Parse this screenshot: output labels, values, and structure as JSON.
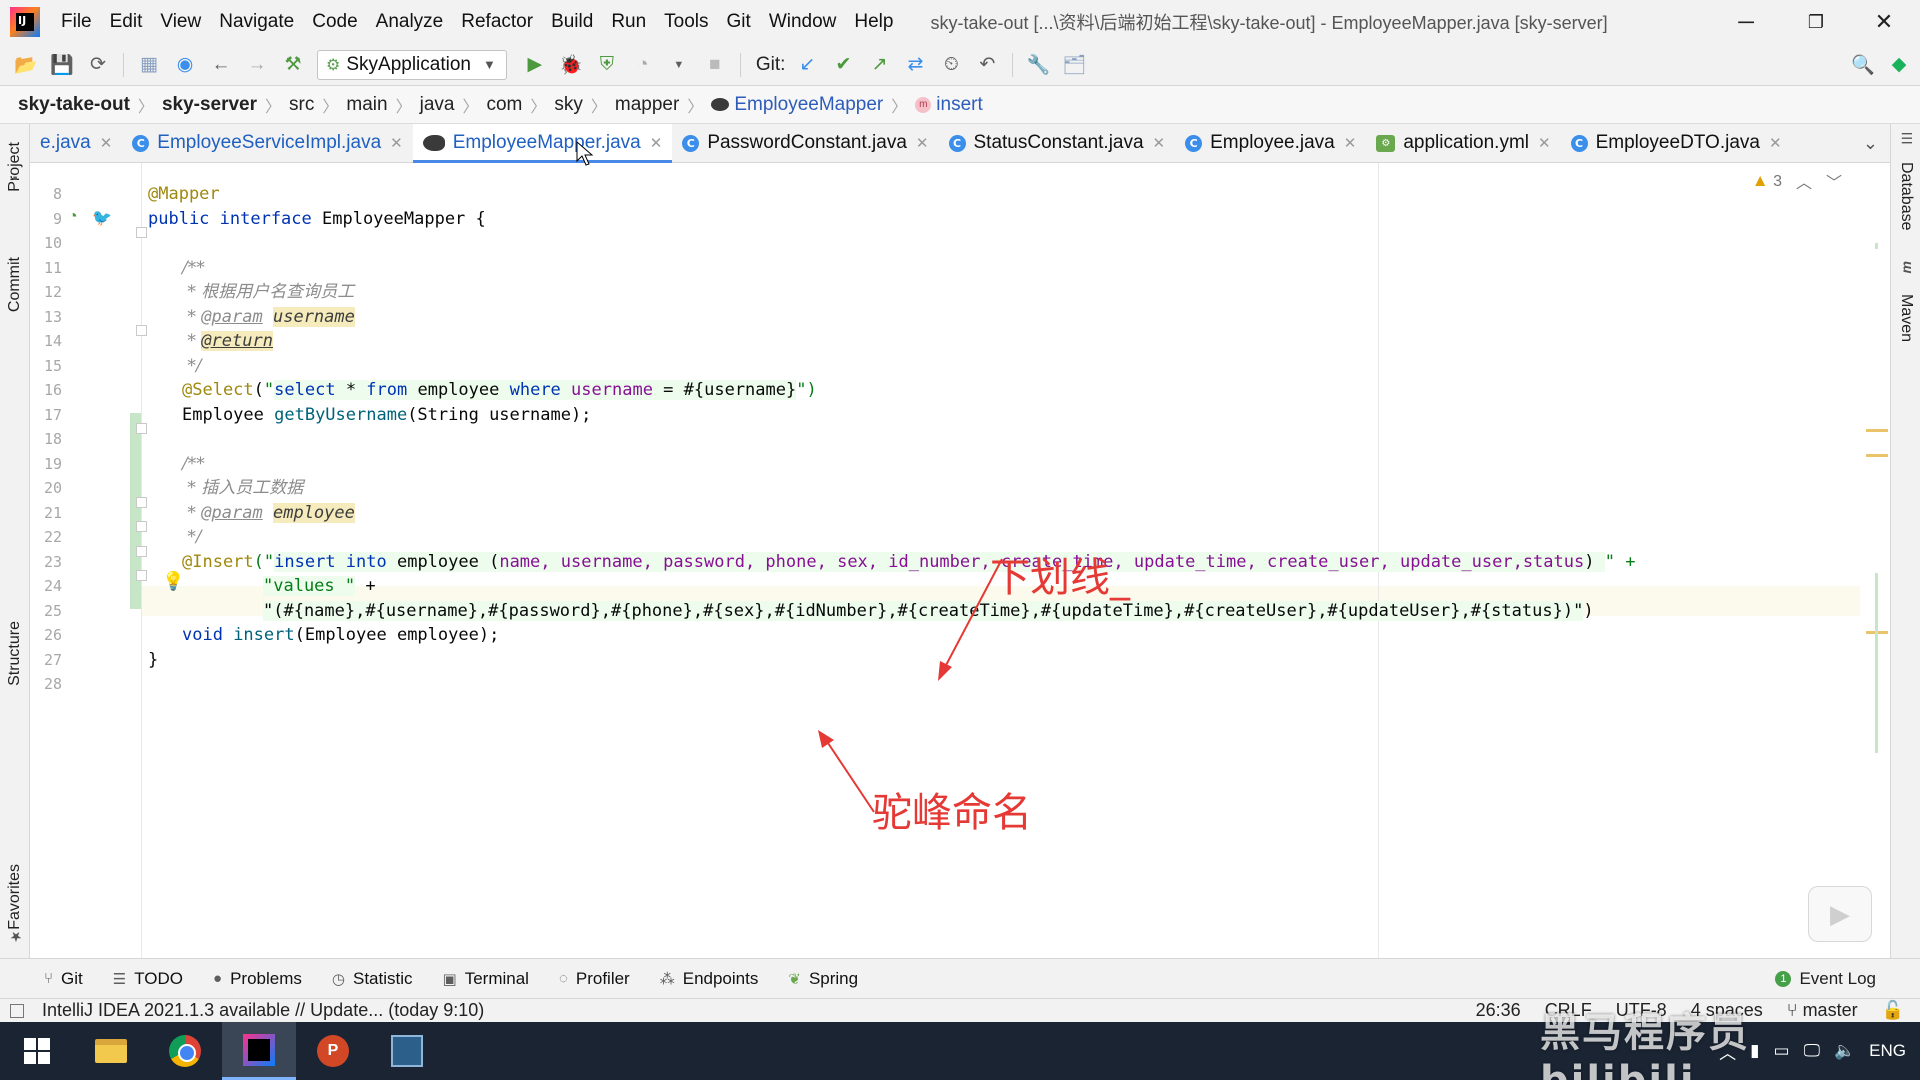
{
  "app": {
    "menu": [
      "File",
      "Edit",
      "View",
      "Navigate",
      "Code",
      "Analyze",
      "Refactor",
      "Build",
      "Run",
      "Tools",
      "Git",
      "Window",
      "Help"
    ],
    "window_title": "sky-take-out [...\\资料\\后端初始工程\\sky-take-out] - EmployeeMapper.java [sky-server]",
    "window_controls": {
      "minimize": "─",
      "restore": "❐",
      "close": "✕"
    }
  },
  "toolbar": {
    "run_config": "SkyApplication",
    "git_label": "Git:"
  },
  "breadcrumb": [
    "sky-take-out",
    "sky-server",
    "src",
    "main",
    "java",
    "com",
    "sky",
    "mapper",
    "EmployeeMapper",
    "insert"
  ],
  "tabs": [
    {
      "label": "e.java",
      "icon": "none",
      "active": false
    },
    {
      "label": "EmployeeServiceImpl.java",
      "icon": "class-icon",
      "active": false
    },
    {
      "label": "EmployeeMapper.java",
      "icon": "mapper-icon",
      "active": true
    },
    {
      "label": "PasswordConstant.java",
      "icon": "class-icon",
      "active": false
    },
    {
      "label": "StatusConstant.java",
      "icon": "class-icon",
      "active": false
    },
    {
      "label": "Employee.java",
      "icon": "class-icon",
      "active": false
    },
    {
      "label": "application.yml",
      "icon": "yaml-icon",
      "active": false
    },
    {
      "label": "EmployeeDTO.java",
      "icon": "class-icon",
      "active": false
    }
  ],
  "left_tool_windows": [
    "Project",
    "Commit",
    "Structure",
    "Favorites"
  ],
  "right_tool_windows": [
    "Database",
    "Maven"
  ],
  "editor": {
    "line_numbers": [
      "8",
      "9",
      "10",
      "11",
      "12",
      "13",
      "14",
      "15",
      "16",
      "17",
      "18",
      "19",
      "20",
      "21",
      "22",
      "23",
      "24",
      "25",
      "26",
      "27",
      "28"
    ],
    "warning_count": "3",
    "lines": {
      "l8": "@Mapper",
      "l9_kw": "public interface",
      "l9_rest": " EmployeeMapper {",
      "l11": "/**",
      "l12": " * 根据用户名查询员工",
      "l13_star": " * ",
      "l13_tag": "@param",
      "l13_sp": " ",
      "l13_param": "username",
      "l14_star": " * ",
      "l14_tag": "@return",
      "l15": " */",
      "l16_ann": "@Select",
      "l16_open": "(",
      "l16_q": "\"",
      "l16_s1": "select",
      "l16_s2": " * ",
      "l16_s3": "from",
      "l16_s4": " employee ",
      "l16_s5": "where",
      "l16_s6": " ",
      "l16_s7": "username",
      "l16_s8": " = #{username}",
      "l16_end": "\")",
      "l17_type": "Employee ",
      "l17_method": "getByUsername",
      "l17_rest": "(String username);",
      "l19": "/**",
      "l20": " * 插入员工数据",
      "l21_star": " * ",
      "l21_tag": "@param",
      "l21_sp": " ",
      "l21_param": "employee",
      "l22": " */",
      "l23_ann": "@Insert",
      "l23_open": "(\"",
      "l23_s1": "insert into",
      "l23_s2": " employee (",
      "l23_cols": "name, username, password, phone, sex, id_number, create_time, update_time, create_user, update_user,status",
      "l23_s3": ") ",
      "l23_end": "\" +",
      "l24_str": "\"values \"",
      "l24_rest": " +",
      "l25_str": "\"(#{name},#{username},#{password},#{phone},#{sex},#{idNumber},#{createTime},#{updateTime},#{createUser},#{updateUser},#{status})\"",
      "l25_rest": ")",
      "l26_kw": "void ",
      "l26_method": "insert",
      "l26_rest": "(Employee employee);",
      "l27": "}"
    }
  },
  "annotations": {
    "underline_note": "下划线_",
    "camel_note": "驼峰命名",
    "color": "#e53935"
  },
  "bottom_tools": [
    "Git",
    "TODO",
    "Problems",
    "Statistic",
    "Terminal",
    "Profiler",
    "Endpoints",
    "Spring"
  ],
  "event_log": "Event Log",
  "status": {
    "message": "IntelliJ IDEA 2021.1.3 available // Update... (today 9:10)",
    "position": "26:36",
    "line_sep": "CRLF",
    "encoding": "UTF-8",
    "indent": "4 spaces",
    "branch": "master"
  },
  "taskbar": {
    "lang": "ENG"
  },
  "watermark": "黑马程序员 bilibili"
}
